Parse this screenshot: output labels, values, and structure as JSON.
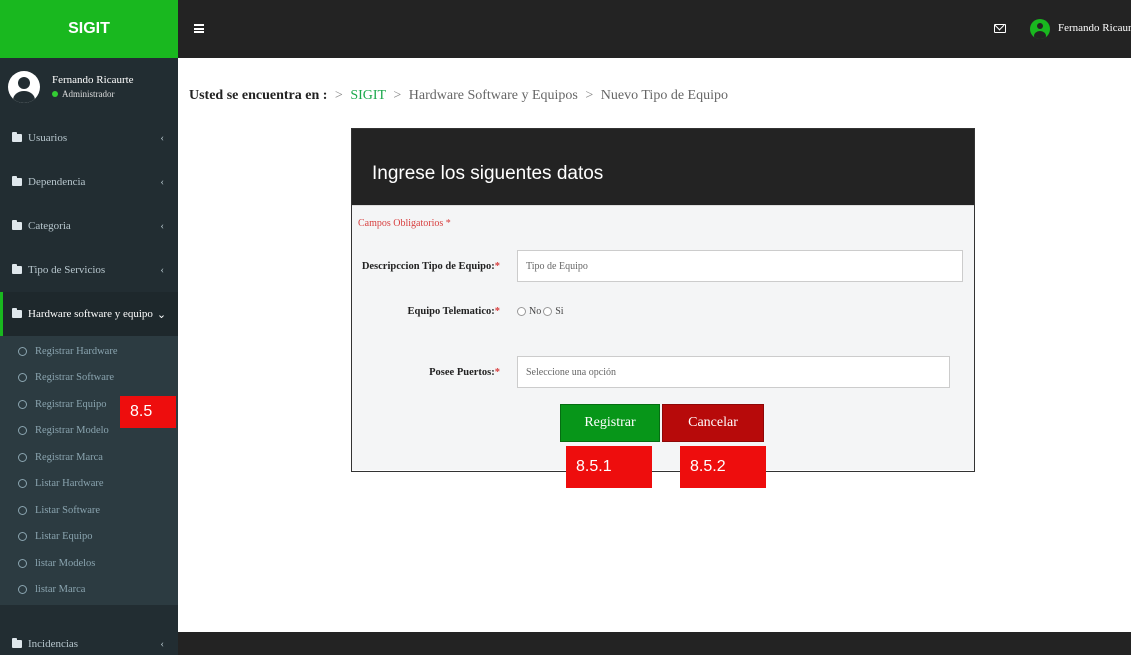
{
  "brand": "SIGIT",
  "user": {
    "name": "Fernando Ricaurte",
    "role": "Administrador",
    "top_name": "Fernando Ricaurte"
  },
  "sidebar": {
    "items": [
      {
        "label": "Usuarios"
      },
      {
        "label": "Dependencia"
      },
      {
        "label": "Categoria"
      },
      {
        "label": "Tipo de Servicios"
      }
    ],
    "active": {
      "label": "Hardware software y equipo"
    },
    "subitems": [
      "Registrar Hardware",
      "Registrar Software",
      "Registrar Equipo",
      "Registrar Modelo",
      "Registrar Marca",
      "Listar Hardware",
      "Listar Software",
      "Listar Equipo",
      "listar Modelos",
      "listar Marca"
    ],
    "bottom": {
      "label": "Incidencias"
    }
  },
  "breadcrumb": {
    "label": "Usted se encuentra en :",
    "sep": ">",
    "root": "SIGIT",
    "section": "Hardware Software y Equipos",
    "current": "Nuevo Tipo de Equipo"
  },
  "form": {
    "title": "Ingrese los siguentes datos",
    "required_note": "Campos Obligatorios",
    "star": "*",
    "desc_label": "Descripccion Tipo de Equipo:",
    "desc_placeholder": "Tipo de Equipo",
    "tele_label": "Equipo Telematico:",
    "opt_no": "No",
    "opt_si": "Si",
    "ports_label": "Posee Puertos:",
    "ports_placeholder": "Seleccione una opción",
    "register": "Registrar",
    "cancel": "Cancelar"
  },
  "annotations": {
    "a": "8.5",
    "b": "8.5.1",
    "c": "8.5.2"
  }
}
